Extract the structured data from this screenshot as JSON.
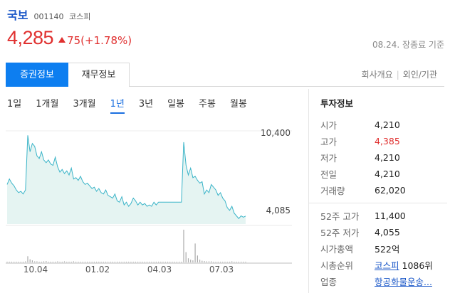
{
  "stock": {
    "name": "국보",
    "code": "001140",
    "market": "코스피",
    "price": "4,285",
    "change": "75(+1.78%)",
    "status": "08.24. 장종료 기준"
  },
  "tabs": {
    "primary": "증권정보",
    "secondary": "재무정보",
    "link1": "회사개요",
    "link2": "외인/기관"
  },
  "periods": [
    "1일",
    "1개월",
    "3개월",
    "1년",
    "3년",
    "일봉",
    "주봉",
    "월봉"
  ],
  "active_period": "1년",
  "chart_data": {
    "type": "area",
    "y_high_label": "10,400",
    "y_low_label": "4,085",
    "x_tick_labels": [
      "10.04",
      "01.02",
      "04.03",
      "07.03"
    ],
    "ylim": [
      3700,
      11000
    ],
    "price_series": [
      6600,
      7000,
      6700,
      6500,
      6200,
      6000,
      6100,
      5900,
      6200,
      10200,
      9000,
      9600,
      9400,
      8700,
      8500,
      9000,
      8400,
      8200,
      8400,
      8100,
      8000,
      8600,
      7900,
      7500,
      7700,
      7400,
      7600,
      7300,
      7800,
      7000,
      7100,
      6900,
      7200,
      6800,
      6600,
      6700,
      6500,
      6300,
      6400,
      6100,
      6300,
      6000,
      5900,
      6200,
      5800,
      5700,
      5600,
      5900,
      5400,
      5300,
      5700,
      5100,
      5300,
      5000,
      5200,
      5600,
      5400,
      5100,
      5300,
      5100,
      5200,
      5000,
      5100,
      5000,
      5300,
      5100,
      5300,
      5300,
      5300,
      5300,
      5300,
      5300,
      5300,
      5300,
      5300,
      5300,
      5300,
      9700,
      8000,
      7300,
      7800,
      7100,
      7200,
      6900,
      6700,
      6800,
      5900,
      6200,
      6000,
      6600,
      6400,
      6200,
      5800,
      6000,
      5600,
      5400,
      4900,
      4700,
      5000,
      4500,
      4300,
      4100,
      4300,
      4200,
      4285
    ],
    "volume_series": [
      2,
      1,
      1,
      2,
      1,
      1,
      1,
      2,
      3,
      18,
      9,
      6,
      3,
      3,
      2,
      2,
      3,
      4,
      2,
      2,
      2,
      2,
      3,
      2,
      2,
      3,
      2,
      2,
      2,
      3,
      2,
      2,
      2,
      1,
      2,
      2,
      2,
      2,
      1,
      2,
      1,
      2,
      2,
      1,
      1,
      1,
      2,
      1,
      1,
      1,
      2,
      1,
      1,
      2,
      1,
      1,
      1,
      2,
      1,
      1,
      1,
      1,
      1,
      1,
      1,
      1,
      1,
      1,
      1,
      1,
      1,
      1,
      1,
      1,
      1,
      1,
      1,
      95,
      30,
      12,
      8,
      6,
      55,
      20,
      8,
      5,
      4,
      3,
      3,
      3,
      2,
      2,
      2,
      2,
      2,
      2,
      2,
      2,
      3,
      2,
      2,
      2,
      2,
      2,
      2
    ],
    "accent": "#3ab4c8"
  },
  "info": {
    "title": "투자정보",
    "rows1": [
      {
        "key": "시가",
        "val": "4,210"
      },
      {
        "key": "고가",
        "val": "4,385"
      },
      {
        "key": "저가",
        "val": "4,210"
      },
      {
        "key": "전일",
        "val": "4,210"
      },
      {
        "key": "거래량",
        "val": "62,020"
      }
    ],
    "rows2": [
      {
        "key": "52주 고가",
        "val": "11,400"
      },
      {
        "key": "52주 저가",
        "val": "4,055"
      },
      {
        "key": "시가총액",
        "val": "522억"
      }
    ],
    "rank_key": "시총순위",
    "rank_market": "코스피",
    "rank_val": "1086위",
    "sector_key": "업종",
    "sector_val": "항공화물운송..."
  }
}
